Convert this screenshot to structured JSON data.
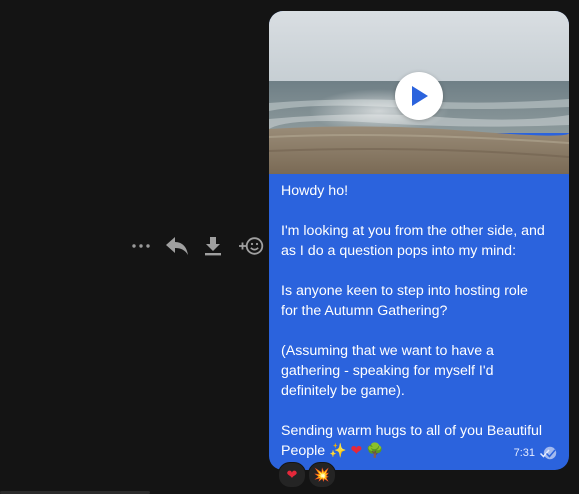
{
  "toolbar": {
    "more_icon": "more-horizontal-icon",
    "reply_icon": "reply-icon",
    "download_icon": "download-icon",
    "react_icon": "add-reaction-icon",
    "react_prefix": "+"
  },
  "message": {
    "lines": [
      "Howdy ho!",
      "",
      "I'm looking at you from the other side, and",
      "as I do a question pops into my mind:",
      "",
      "Is anyone keen to step into hosting role",
      "for the Autumn Gathering?",
      "",
      "(Assuming that we want to have a",
      "gathering - speaking for myself I'd",
      "definitely be game).",
      "",
      "Sending warm hugs to all of you Beautiful"
    ],
    "last_line_text": "People",
    "last_line_emojis": [
      "✨",
      "❤",
      "🌳"
    ],
    "time": "7:31",
    "status_icon": "read-checkmark-icon",
    "bubble_color": "#2b63dd",
    "video": {
      "play_icon": "play-icon"
    }
  },
  "reactions": [
    {
      "emoji": "❤",
      "name": "heart"
    },
    {
      "emoji": "💥",
      "name": "collision"
    }
  ]
}
